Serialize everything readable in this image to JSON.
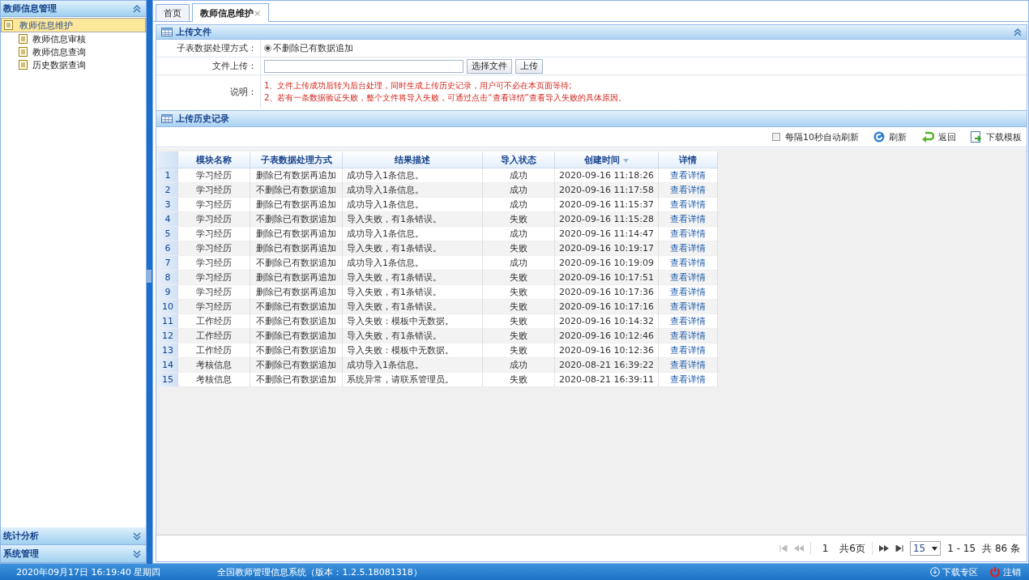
{
  "sidebar": {
    "title": "教师信息管理",
    "expanded": true,
    "items": [
      {
        "label": "教师信息维护",
        "selected": true
      },
      {
        "label": "教师信息审核",
        "selected": false
      },
      {
        "label": "教师信息查询",
        "selected": false
      },
      {
        "label": "历史数据查询",
        "selected": false
      }
    ],
    "sections": [
      {
        "label": "统计分析",
        "expanded": false
      },
      {
        "label": "系统管理",
        "expanded": false
      }
    ]
  },
  "tabs": [
    {
      "label": "首页",
      "selected": false
    },
    {
      "label": "教师信息维护",
      "selected": true,
      "close": "×"
    }
  ],
  "upload_panel": {
    "title": "上传文件",
    "expanded": true,
    "mode_label": "子表数据处理方式：",
    "mode_option": {
      "label": "不删除已有数据追加",
      "selected": true
    },
    "file_label": "文件上传：",
    "choose_button": "选择文件",
    "upload_button": "上传",
    "notes_label": "说明：",
    "notes": [
      "1、文件上传成功后转为后台处理，同时生成上传历史记录，用户可不必在本页面等待;",
      "2、若有一条数据验证失败，整个文件将导入失败，可通过点击“查看详情”查看导入失败的具体原因。"
    ]
  },
  "history": {
    "title": "上传历史记录",
    "auto_refresh": {
      "label": "每隔10秒自动刷新",
      "checked": false
    },
    "toolbar": [
      {
        "kind": "refresh",
        "label": "刷新"
      },
      {
        "kind": "back",
        "label": "返回"
      },
      {
        "kind": "download",
        "label": "下载模板"
      }
    ],
    "columns": [
      {
        "label": "模块名称",
        "sorted": false
      },
      {
        "label": "子表数据处理方式",
        "sorted": false
      },
      {
        "label": "结果描述",
        "sorted": false
      },
      {
        "label": "导入状态",
        "sorted": false
      },
      {
        "label": "创建时间",
        "sorted": true
      },
      {
        "label": "详情",
        "sorted": false
      }
    ],
    "rows": [
      {
        "number": "1",
        "cells": [
          "学习经历",
          "删除已有数据再追加",
          "成功导入1条信息。",
          "成功",
          "2020-09-16 11:18:26",
          "查看详情"
        ]
      },
      {
        "number": "2",
        "cells": [
          "学习经历",
          "不删除已有数据追加",
          "成功导入1条信息。",
          "成功",
          "2020-09-16 11:17:58",
          "查看详情"
        ]
      },
      {
        "number": "3",
        "cells": [
          "学习经历",
          "删除已有数据再追加",
          "成功导入1条信息。",
          "成功",
          "2020-09-16 11:15:37",
          "查看详情"
        ]
      },
      {
        "number": "4",
        "cells": [
          "学习经历",
          "不删除已有数据追加",
          "导入失败，有1条错误。",
          "失败",
          "2020-09-16 11:15:28",
          "查看详情"
        ]
      },
      {
        "number": "5",
        "cells": [
          "学习经历",
          "删除已有数据再追加",
          "成功导入1条信息。",
          "成功",
          "2020-09-16 11:14:47",
          "查看详情"
        ]
      },
      {
        "number": "6",
        "cells": [
          "学习经历",
          "删除已有数据再追加",
          "导入失败，有1条错误。",
          "失败",
          "2020-09-16 10:19:17",
          "查看详情"
        ]
      },
      {
        "number": "7",
        "cells": [
          "学习经历",
          "不删除已有数据追加",
          "成功导入1条信息。",
          "成功",
          "2020-09-16 10:19:09",
          "查看详情"
        ]
      },
      {
        "number": "8",
        "cells": [
          "学习经历",
          "删除已有数据再追加",
          "导入失败，有1条错误。",
          "失败",
          "2020-09-16 10:17:51",
          "查看详情"
        ]
      },
      {
        "number": "9",
        "cells": [
          "学习经历",
          "删除已有数据再追加",
          "导入失败，有1条错误。",
          "失败",
          "2020-09-16 10:17:36",
          "查看详情"
        ]
      },
      {
        "number": "10",
        "cells": [
          "学习经历",
          "不删除已有数据追加",
          "导入失败，有1条错误。",
          "失败",
          "2020-09-16 10:17:16",
          "查看详情"
        ]
      },
      {
        "number": "11",
        "cells": [
          "工作经历",
          "不删除已有数据追加",
          "导入失败：模板中无数据。",
          "失败",
          "2020-09-16 10:14:32",
          "查看详情"
        ]
      },
      {
        "number": "12",
        "cells": [
          "工作经历",
          "不删除已有数据追加",
          "导入失败，有1条错误。",
          "失败",
          "2020-09-16 10:12:46",
          "查看详情"
        ]
      },
      {
        "number": "13",
        "cells": [
          "工作经历",
          "不删除已有数据追加",
          "导入失败：模板中无数据。",
          "失败",
          "2020-09-16 10:12:36",
          "查看详情"
        ]
      },
      {
        "number": "14",
        "cells": [
          "考核信息",
          "不删除已有数据追加",
          "成功导入1条信息。",
          "成功",
          "2020-08-21 16:39:22",
          "查看详情"
        ]
      },
      {
        "number": "15",
        "cells": [
          "考核信息",
          "不删除已有数据追加",
          "系统异常，请联系管理员。",
          "失败",
          "2020-08-21 16:39:11",
          "查看详情"
        ]
      }
    ],
    "pagination": {
      "page": "1",
      "pages": "共6页",
      "page_size": "15",
      "range": "1 - 15",
      "total": "共 86 条",
      "first_disabled": true,
      "last_disabled": false
    }
  },
  "status_bar": {
    "datetime": "2020年09月17日  16:19:40  星期四",
    "system": "全国教师管理信息系统（版本：1.2.5.18081318）",
    "download": "下载专区",
    "logout": "注销"
  }
}
